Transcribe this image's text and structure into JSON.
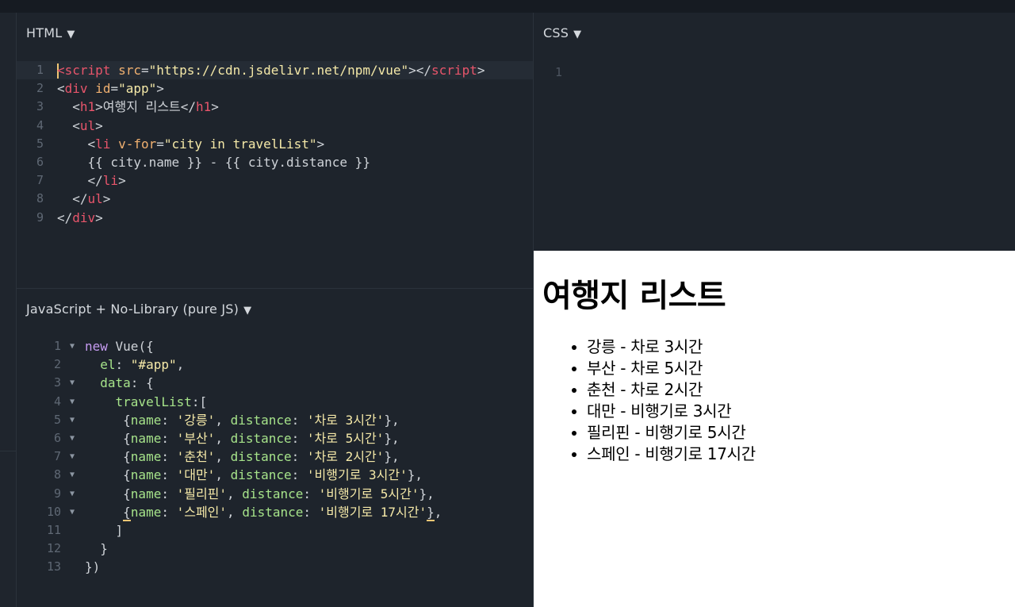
{
  "panels": {
    "html": {
      "title": "HTML",
      "lines": [
        {
          "n": "1",
          "segs": [
            [
              "tag",
              "<"
            ],
            [
              "tag",
              "script"
            ],
            [
              "attr",
              " src"
            ],
            [
              "punc",
              "="
            ],
            [
              "str",
              "\"https://cdn.jsdelivr.net/npm/vue\""
            ],
            [
              "punc",
              ">"
            ],
            [
              "punc",
              "</"
            ],
            [
              "tag",
              "script"
            ],
            [
              "punc",
              ">"
            ]
          ]
        },
        {
          "n": "2",
          "segs": [
            [
              "punc",
              "<"
            ],
            [
              "tag",
              "div"
            ],
            [
              "attr",
              " id"
            ],
            [
              "punc",
              "="
            ],
            [
              "str",
              "\"app\""
            ],
            [
              "punc",
              ">"
            ]
          ]
        },
        {
          "n": "3",
          "segs": [
            [
              "punc",
              "  <"
            ],
            [
              "tag",
              "h1"
            ],
            [
              "punc",
              ">여행지 리스트</"
            ],
            [
              "tag",
              "h1"
            ],
            [
              "punc",
              ">"
            ]
          ]
        },
        {
          "n": "4",
          "segs": [
            [
              "punc",
              "  <"
            ],
            [
              "tag",
              "ul"
            ],
            [
              "punc",
              ">"
            ]
          ]
        },
        {
          "n": "5",
          "segs": [
            [
              "punc",
              "    <"
            ],
            [
              "tag",
              "li"
            ],
            [
              "attr",
              " v-for"
            ],
            [
              "punc",
              "="
            ],
            [
              "str",
              "\"city in travelList\""
            ],
            [
              "punc",
              ">"
            ]
          ]
        },
        {
          "n": "6",
          "segs": [
            [
              "punc",
              "    {{ city.name }} - {{ city.distance }}"
            ]
          ]
        },
        {
          "n": "7",
          "segs": [
            [
              "punc",
              "    </"
            ],
            [
              "tag",
              "li"
            ],
            [
              "punc",
              ">"
            ]
          ]
        },
        {
          "n": "8",
          "segs": [
            [
              "punc",
              "  </"
            ],
            [
              "tag",
              "ul"
            ],
            [
              "punc",
              ">"
            ]
          ]
        },
        {
          "n": "9",
          "segs": [
            [
              "punc",
              "</"
            ],
            [
              "tag",
              "div"
            ],
            [
              "punc",
              ">"
            ]
          ]
        }
      ]
    },
    "css": {
      "title": "CSS",
      "lines": [
        {
          "n": "1",
          "segs": []
        }
      ]
    },
    "js": {
      "title": "JavaScript + No-Library (pure JS)",
      "lines": [
        {
          "n": "1",
          "fold": true,
          "segs": [
            [
              "kw",
              "new"
            ],
            [
              "punc",
              " Vue({"
            ]
          ]
        },
        {
          "n": "2",
          "fold": false,
          "segs": [
            [
              "key",
              "  el"
            ],
            [
              "punc",
              ": "
            ],
            [
              "str",
              "\"#app\""
            ],
            [
              "punc",
              ","
            ]
          ]
        },
        {
          "n": "3",
          "fold": true,
          "segs": [
            [
              "key",
              "  data"
            ],
            [
              "punc",
              ": {"
            ]
          ]
        },
        {
          "n": "4",
          "fold": true,
          "segs": [
            [
              "key",
              "    travelList"
            ],
            [
              "punc",
              ":["
            ]
          ]
        },
        {
          "n": "5",
          "fold": true,
          "segs": [
            [
              "punc",
              "     {"
            ],
            [
              "key",
              "name"
            ],
            [
              "punc",
              ": "
            ],
            [
              "str",
              "'강릉'"
            ],
            [
              "punc",
              ", "
            ],
            [
              "key",
              "distance"
            ],
            [
              "punc",
              ": "
            ],
            [
              "str",
              "'차로 3시간'"
            ],
            [
              "punc",
              "},"
            ]
          ]
        },
        {
          "n": "6",
          "fold": true,
          "segs": [
            [
              "punc",
              "     {"
            ],
            [
              "key",
              "name"
            ],
            [
              "punc",
              ": "
            ],
            [
              "str",
              "'부산'"
            ],
            [
              "punc",
              ", "
            ],
            [
              "key",
              "distance"
            ],
            [
              "punc",
              ": "
            ],
            [
              "str",
              "'차로 5시간'"
            ],
            [
              "punc",
              "},"
            ]
          ]
        },
        {
          "n": "7",
          "fold": true,
          "segs": [
            [
              "punc",
              "     {"
            ],
            [
              "key",
              "name"
            ],
            [
              "punc",
              ": "
            ],
            [
              "str",
              "'춘천'"
            ],
            [
              "punc",
              ", "
            ],
            [
              "key",
              "distance"
            ],
            [
              "punc",
              ": "
            ],
            [
              "str",
              "'차로 2시간'"
            ],
            [
              "punc",
              "},"
            ]
          ]
        },
        {
          "n": "8",
          "fold": true,
          "segs": [
            [
              "punc",
              "     {"
            ],
            [
              "key",
              "name"
            ],
            [
              "punc",
              ": "
            ],
            [
              "str",
              "'대만'"
            ],
            [
              "punc",
              ", "
            ],
            [
              "key",
              "distance"
            ],
            [
              "punc",
              ": "
            ],
            [
              "str",
              "'비행기로 3시간'"
            ],
            [
              "punc",
              "},"
            ]
          ]
        },
        {
          "n": "9",
          "fold": true,
          "segs": [
            [
              "punc",
              "     {"
            ],
            [
              "key",
              "name"
            ],
            [
              "punc",
              ": "
            ],
            [
              "str",
              "'필리핀'"
            ],
            [
              "punc",
              ", "
            ],
            [
              "key",
              "distance"
            ],
            [
              "punc",
              ": "
            ],
            [
              "str",
              "'비행기로 5시간'"
            ],
            [
              "punc",
              "},"
            ]
          ]
        },
        {
          "n": "10",
          "fold": true,
          "segs": [
            [
              "punc",
              "     "
            ],
            [
              "punc_u",
              "{"
            ],
            [
              "key",
              "name"
            ],
            [
              "punc",
              ": "
            ],
            [
              "str",
              "'스페인'"
            ],
            [
              "punc",
              ", "
            ],
            [
              "key",
              "distance"
            ],
            [
              "punc",
              ": "
            ],
            [
              "str",
              "'비행기로 17시간'"
            ],
            [
              "punc_u",
              "}"
            ],
            [
              "punc",
              ","
            ]
          ]
        },
        {
          "n": "11",
          "fold": false,
          "segs": [
            [
              "punc",
              "    ]"
            ]
          ]
        },
        {
          "n": "12",
          "fold": false,
          "segs": [
            [
              "punc",
              "  }"
            ]
          ]
        },
        {
          "n": "13",
          "fold": false,
          "segs": [
            [
              "punc",
              "})"
            ]
          ]
        }
      ]
    }
  },
  "output": {
    "heading": "여행지 리스트",
    "items": [
      "강릉 - 차로 3시간",
      "부산 - 차로 5시간",
      "춘천 - 차로 2시간",
      "대만 - 비행기로 3시간",
      "필리핀 - 비행기로 5시간",
      "스페인 - 비행기로 17시간"
    ]
  },
  "icons": {
    "panel_menu": "triangle-down-icon",
    "fold": "fold-arrow-icon"
  },
  "colors": {
    "tag": "#e8556b",
    "attr": "#f0b070",
    "string": "#f5e9a8",
    "keyword": "#c59bf0",
    "key": "#a6e38a",
    "editor_bg": "#1e242c"
  }
}
